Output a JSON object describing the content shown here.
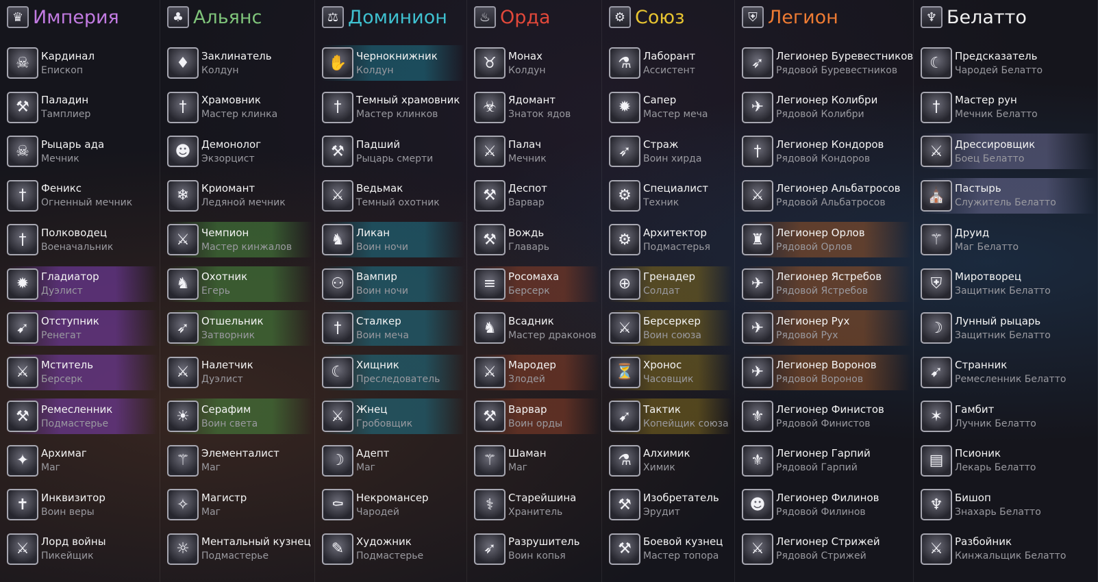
{
  "factions": [
    {
      "key": "empire",
      "name": "Империя",
      "color": "#c27be2",
      "hl": "rgba(120,60,170,0.60)",
      "icon": "crown-skull-icon",
      "glyph": "♛",
      "classes": [
        {
          "name": "Кардинал",
          "sub": "Епископ",
          "icon": "skull-icon",
          "glyph": "☠"
        },
        {
          "name": "Паладин",
          "sub": "Тамплиер",
          "icon": "hammer-icon",
          "glyph": "⚒"
        },
        {
          "name": "Рыцарь ада",
          "sub": "Мечник",
          "icon": "hellknight-icon",
          "glyph": "☠"
        },
        {
          "name": "Феникс",
          "sub": "Огненный мечник",
          "icon": "phoenix-sword-icon",
          "glyph": "†"
        },
        {
          "name": "Полководец",
          "sub": "Военачальник",
          "icon": "winged-sword-icon",
          "glyph": "†"
        },
        {
          "name": "Гладиатор",
          "sub": "Дуэлист",
          "icon": "eagle-emblem-icon",
          "glyph": "✹",
          "hl": true
        },
        {
          "name": "Отступник",
          "sub": "Ренегат",
          "icon": "crossbow-icon",
          "glyph": "➹",
          "hl": true
        },
        {
          "name": "Мститель",
          "sub": "Берсерк",
          "icon": "wing-icon",
          "glyph": "⚔",
          "hl": true
        },
        {
          "name": "Ремесленник",
          "sub": "Подмастерье",
          "icon": "anvil-hammer-icon",
          "glyph": "⚒",
          "hl": true
        },
        {
          "name": "Архимаг",
          "sub": "Маг",
          "icon": "winged-emblem-icon",
          "glyph": "✦"
        },
        {
          "name": "Инквизитор",
          "sub": "Воин веры",
          "icon": "flail-icon",
          "glyph": "✝"
        },
        {
          "name": "Лорд войны",
          "sub": "Пикейщик",
          "icon": "halberd-icon",
          "glyph": "⚔"
        }
      ]
    },
    {
      "key": "alliance",
      "name": "Альянс",
      "color": "#7fc47a",
      "hl": "rgba(70,130,60,0.60)",
      "icon": "tree-icon",
      "glyph": "♣",
      "classes": [
        {
          "name": "Заклинатель",
          "sub": "Колдун",
          "icon": "crystal-icon",
          "glyph": "♦"
        },
        {
          "name": "Храмовник",
          "sub": "Мастер клинка",
          "icon": "sword-icon",
          "glyph": "†"
        },
        {
          "name": "Демонолог",
          "sub": "Экзорцист",
          "icon": "demon-head-icon",
          "glyph": "☻"
        },
        {
          "name": "Криомант",
          "sub": "Ледяной мечник",
          "icon": "ice-sword-icon",
          "glyph": "❄"
        },
        {
          "name": "Чемпион",
          "sub": "Мастер кинжалов",
          "icon": "crossed-daggers-icon",
          "glyph": "⚔",
          "hl": true
        },
        {
          "name": "Охотник",
          "sub": "Егерь",
          "icon": "wolf-head-icon",
          "glyph": "♞",
          "hl": true
        },
        {
          "name": "Отшельник",
          "sub": "Затворник",
          "icon": "arrows-icon",
          "glyph": "➶",
          "hl": true
        },
        {
          "name": "Налетчик",
          "sub": "Дуэлист",
          "icon": "swords-icon",
          "glyph": "⚔"
        },
        {
          "name": "Серафим",
          "sub": "Воин света",
          "icon": "light-orb-icon",
          "glyph": "☀",
          "hl": true
        },
        {
          "name": "Элементалист",
          "sub": "Маг",
          "icon": "staff-icon",
          "glyph": "⚚"
        },
        {
          "name": "Магистр",
          "sub": "Маг",
          "icon": "scepter-icon",
          "glyph": "✧"
        },
        {
          "name": "Ментальный кузнец",
          "sub": "Подмастерье",
          "icon": "eye-sun-icon",
          "glyph": "☼"
        }
      ]
    },
    {
      "key": "dominion",
      "name": "Доминион",
      "color": "#3fc1d0",
      "hl": "rgba(30,110,130,0.60)",
      "icon": "scale-icon",
      "glyph": "⚖",
      "classes": [
        {
          "name": "Чернокнижник",
          "sub": "Колдун",
          "icon": "claw-hand-icon",
          "glyph": "✋",
          "hl": true
        },
        {
          "name": "Темный храмовник",
          "sub": "Мастер клинков",
          "icon": "dark-sword-icon",
          "glyph": "†"
        },
        {
          "name": "Падший",
          "sub": "Рыцарь смерти",
          "icon": "axe-icon",
          "glyph": "⚒"
        },
        {
          "name": "Ведьмак",
          "sub": "Темный охотник",
          "icon": "gate-icon",
          "glyph": "⚔"
        },
        {
          "name": "Ликан",
          "sub": "Воин ночи",
          "icon": "werewolf-icon",
          "glyph": "♞",
          "hl": true
        },
        {
          "name": "Вампир",
          "sub": "Воин ночи",
          "icon": "bat-icon",
          "glyph": "⚇",
          "hl": true
        },
        {
          "name": "Сталкер",
          "sub": "Воин меча",
          "icon": "dagger-icon",
          "glyph": "†",
          "hl": true
        },
        {
          "name": "Хищник",
          "sub": "Преследователь",
          "icon": "fangs-icon",
          "glyph": "☾",
          "hl": true
        },
        {
          "name": "Жнец",
          "sub": "Гробовщик",
          "icon": "scythes-icon",
          "glyph": "⚔",
          "hl": true
        },
        {
          "name": "Адепт",
          "sub": "Маг",
          "icon": "moon-staff-icon",
          "glyph": "☽"
        },
        {
          "name": "Некромансер",
          "sub": "Чародей",
          "icon": "tombstone-icon",
          "glyph": "⚰"
        },
        {
          "name": "Художник",
          "sub": "Подмастерье",
          "icon": "brush-icon",
          "glyph": "✎"
        }
      ]
    },
    {
      "key": "horde",
      "name": "Орда",
      "color": "#e2483a",
      "hl": "rgba(130,60,40,0.60)",
      "icon": "demon-mask-icon",
      "glyph": "♨",
      "classes": [
        {
          "name": "Монах",
          "sub": "Колдун",
          "icon": "horned-skull-icon",
          "glyph": "♉"
        },
        {
          "name": "Ядомант",
          "sub": "Знаток ядов",
          "icon": "poison-totem-icon",
          "glyph": "☣"
        },
        {
          "name": "Палач",
          "sub": "Мечник",
          "icon": "cleaver-icon",
          "glyph": "⚔"
        },
        {
          "name": "Деспот",
          "sub": "Варвар",
          "icon": "club-icon",
          "glyph": "⚒"
        },
        {
          "name": "Вождь",
          "sub": "Главарь",
          "icon": "war-axe-icon",
          "glyph": "⚒"
        },
        {
          "name": "Росомаха",
          "sub": "Берсерк",
          "icon": "claws-icon",
          "glyph": "≡",
          "hl": true
        },
        {
          "name": "Всадник",
          "sub": "Мастер драконов",
          "icon": "dragon-icon",
          "glyph": "♞"
        },
        {
          "name": "Мародер",
          "sub": "Злодей",
          "icon": "twin-axes-icon",
          "glyph": "⚔",
          "hl": true
        },
        {
          "name": "Варвар",
          "sub": "Воин орды",
          "icon": "battleaxe-icon",
          "glyph": "⚒",
          "hl": true
        },
        {
          "name": "Шаман",
          "sub": "Маг",
          "icon": "totem-staff-icon",
          "glyph": "⚚"
        },
        {
          "name": "Старейшина",
          "sub": "Хранитель",
          "icon": "bone-staff-icon",
          "glyph": "⚕"
        },
        {
          "name": "Разрушитель",
          "sub": "Воин копья",
          "icon": "spear-icon",
          "glyph": "➶"
        }
      ]
    },
    {
      "key": "union",
      "name": "Союз",
      "color": "#e7c431",
      "hl": "rgba(120,100,30,0.60)",
      "icon": "gear-shield-icon",
      "glyph": "⚙",
      "classes": [
        {
          "name": "Лаборант",
          "sub": "Ассистент",
          "icon": "flask-icon",
          "glyph": "⚗"
        },
        {
          "name": "Сапер",
          "sub": "Мастер меча",
          "icon": "mine-icon",
          "glyph": "✹"
        },
        {
          "name": "Страж",
          "sub": "Воин хирда",
          "icon": "lance-icon",
          "glyph": "➶"
        },
        {
          "name": "Специалист",
          "sub": "Техник",
          "icon": "gears-icon",
          "glyph": "⚙"
        },
        {
          "name": "Архитектор",
          "sub": "Подмастерья",
          "icon": "cog-wheel-icon",
          "glyph": "⚙"
        },
        {
          "name": "Гренадер",
          "sub": "Солдат",
          "icon": "crosshair-icon",
          "glyph": "⊕",
          "hl": true
        },
        {
          "name": "Берсеркер",
          "sub": "Воин союза",
          "icon": "double-axe-icon",
          "glyph": "⚔",
          "hl": true
        },
        {
          "name": "Хронос",
          "sub": "Часовщик",
          "icon": "clock-icon",
          "glyph": "⏳",
          "hl": true
        },
        {
          "name": "Тактик",
          "sub": "Копейщик союза",
          "icon": "drill-icon",
          "glyph": "➹",
          "hl": true
        },
        {
          "name": "Алхимик",
          "sub": "Химик",
          "icon": "cauldron-icon",
          "glyph": "⚗"
        },
        {
          "name": "Изобретатель",
          "sub": "Эрудит",
          "icon": "wrench-icon",
          "glyph": "⚒"
        },
        {
          "name": "Боевой кузнец",
          "sub": "Мастер топора",
          "icon": "anvil-icon",
          "glyph": "⚒"
        }
      ]
    },
    {
      "key": "legion",
      "name": "Легион",
      "color": "#ee7b33",
      "hl": "rgba(140,80,40,0.60)",
      "icon": "sword-shield-icon",
      "glyph": "⛨",
      "classes": [
        {
          "name": "Легионер Буревестников",
          "sub": "Рядовой Буревестников",
          "icon": "bow-icon",
          "glyph": "➶"
        },
        {
          "name": "Легионер Колибри",
          "sub": "Рядовой Колибри",
          "icon": "hummingbird-icon",
          "glyph": "✈"
        },
        {
          "name": "Легионер Кондоров",
          "sub": "Рядовой Кондоров",
          "icon": "broadsword-icon",
          "glyph": "†"
        },
        {
          "name": "Легионер Альбатросов",
          "sub": "Рядовой Альбатросов",
          "icon": "albatross-icon",
          "glyph": "⚔"
        },
        {
          "name": "Легионер Орлов",
          "sub": "Рядовой Орлов",
          "icon": "eagle-head-icon",
          "glyph": "♜",
          "hl": true
        },
        {
          "name": "Легионер Ястребов",
          "sub": "Рядовой Ястребов",
          "icon": "hawk-icon",
          "glyph": "✈",
          "hl": true
        },
        {
          "name": "Легионер Рух",
          "sub": "Рядовой Рух",
          "icon": "roc-icon",
          "glyph": "✈",
          "hl": true
        },
        {
          "name": "Легионер Воронов",
          "sub": "Рядовой Воронов",
          "icon": "raven-icon",
          "glyph": "✈",
          "hl": true
        },
        {
          "name": "Легионер Финистов",
          "sub": "Рядовой Финистов",
          "icon": "falcon-icon",
          "glyph": "⚜"
        },
        {
          "name": "Легионер Гарпий",
          "sub": "Рядовой Гарпий",
          "icon": "harpy-icon",
          "glyph": "⚜"
        },
        {
          "name": "Легионер Филинов",
          "sub": "Рядовой Филинов",
          "icon": "owl-icon",
          "glyph": "☻"
        },
        {
          "name": "Легионер Стрижей",
          "sub": "Рядовой Стрижей",
          "icon": "swift-icon",
          "glyph": "⚔"
        }
      ]
    },
    {
      "key": "belatto",
      "name": "Белатто",
      "color": "#f0f0f0",
      "hl": "rgba(110,110,150,0.55)",
      "icon": "trident-emblem-icon",
      "glyph": "♆",
      "classes": [
        {
          "name": "Предсказатель",
          "sub": "Чародей Белатто",
          "icon": "crescent-staff-icon",
          "glyph": "☾"
        },
        {
          "name": "Мастер рун",
          "sub": "Мечник Белатто",
          "icon": "rune-sword-icon",
          "glyph": "†"
        },
        {
          "name": "Дрессировщик",
          "sub": "Боец Белатто",
          "icon": "crossed-blades-icon",
          "glyph": "⚔",
          "hl": true
        },
        {
          "name": "Пастырь",
          "sub": "Служитель Белатто",
          "icon": "cathedral-icon",
          "glyph": "⛪",
          "hl": true
        },
        {
          "name": "Друид",
          "sub": "Маг Белатто",
          "icon": "druid-staff-icon",
          "glyph": "⚚"
        },
        {
          "name": "Миротворец",
          "sub": "Защитник Белатто",
          "icon": "helmet-icon",
          "glyph": "⛨"
        },
        {
          "name": "Лунный рыцарь",
          "sub": "Защитник Белатто",
          "icon": "moon-knight-icon",
          "glyph": "☽"
        },
        {
          "name": "Странник",
          "sub": "Ремесленник Белатто",
          "icon": "compass-bow-icon",
          "glyph": "➹"
        },
        {
          "name": "Гамбит",
          "sub": "Лучник Белатто",
          "icon": "arrow-burst-icon",
          "glyph": "✶"
        },
        {
          "name": "Псионик",
          "sub": "Лекарь Белатто",
          "icon": "tome-icon",
          "glyph": "▤"
        },
        {
          "name": "Бишоп",
          "sub": "Знахарь Белатто",
          "icon": "trident-icon",
          "glyph": "♆"
        },
        {
          "name": "Разбойник",
          "sub": "Кинжальщик Белатто",
          "icon": "dagger-crossed-icon",
          "glyph": "⚔"
        }
      ]
    }
  ]
}
